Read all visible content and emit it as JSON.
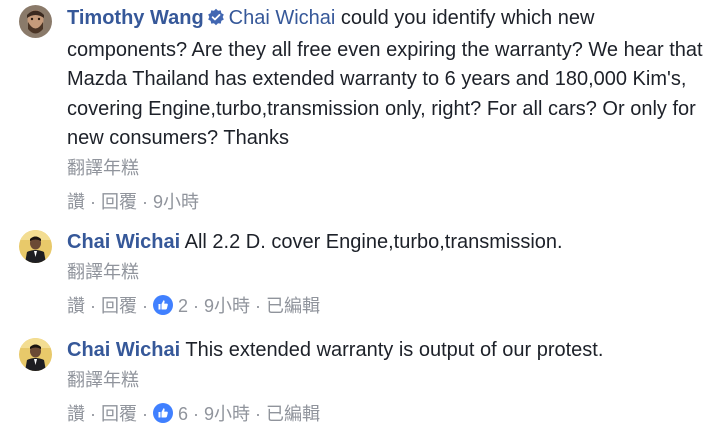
{
  "comments": [
    {
      "author": "Timothy Wang",
      "verified_icon": "verified-badge-icon",
      "mention": "Chai Wichai",
      "text": " could you identify which new components? Are they all free even expiring the warranty? We hear that Mazda Thailand has extended warranty to 6 years and 180,000 Kim's, covering Engine,turbo,transmission only, right? For all cars? Or only for new consumers? Thanks",
      "translate_label": "翻譯年糕",
      "like_label": "讚",
      "reply_label": "回覆",
      "time": "9小時",
      "like_count": ""
    },
    {
      "author": "Chai Wichai",
      "text": "All 2.2 D. cover Engine,turbo,transmission.",
      "translate_label": "翻譯年糕",
      "like_label": "讚",
      "reply_label": "回覆",
      "like_count": "2",
      "time": "9小時",
      "edited_label": "已編輯"
    },
    {
      "author": "Chai Wichai",
      "text": "This extended warranty is output of our protest.",
      "translate_label": "翻譯年糕",
      "like_label": "讚",
      "reply_label": "回覆",
      "like_count": "6",
      "time": "9小時",
      "edited_label": "已編輯"
    }
  ],
  "colors": {
    "link": "#365899",
    "meta": "#90949c",
    "text": "#1d2129",
    "like_badge": "#4080ff"
  }
}
